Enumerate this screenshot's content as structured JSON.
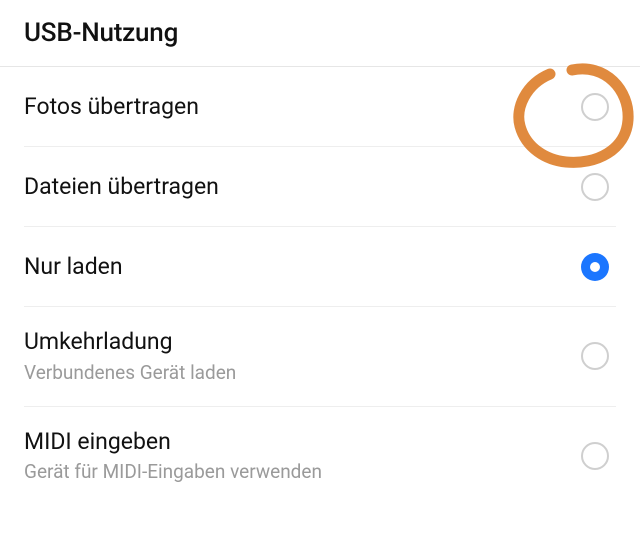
{
  "header": {
    "title": "USB-Nutzung"
  },
  "options": [
    {
      "label": "Fotos übertragen",
      "sub": "",
      "selected": false
    },
    {
      "label": "Dateien übertragen",
      "sub": "",
      "selected": false
    },
    {
      "label": "Nur laden",
      "sub": "",
      "selected": true
    },
    {
      "label": "Umkehrladung",
      "sub": "Verbundenes Gerät laden",
      "selected": false
    },
    {
      "label": "MIDI eingeben",
      "sub": "Gerät für MIDI-Eingaben verwenden",
      "selected": false
    }
  ],
  "colors": {
    "accent": "#1b76ff",
    "annotation": "#e08a3e"
  }
}
